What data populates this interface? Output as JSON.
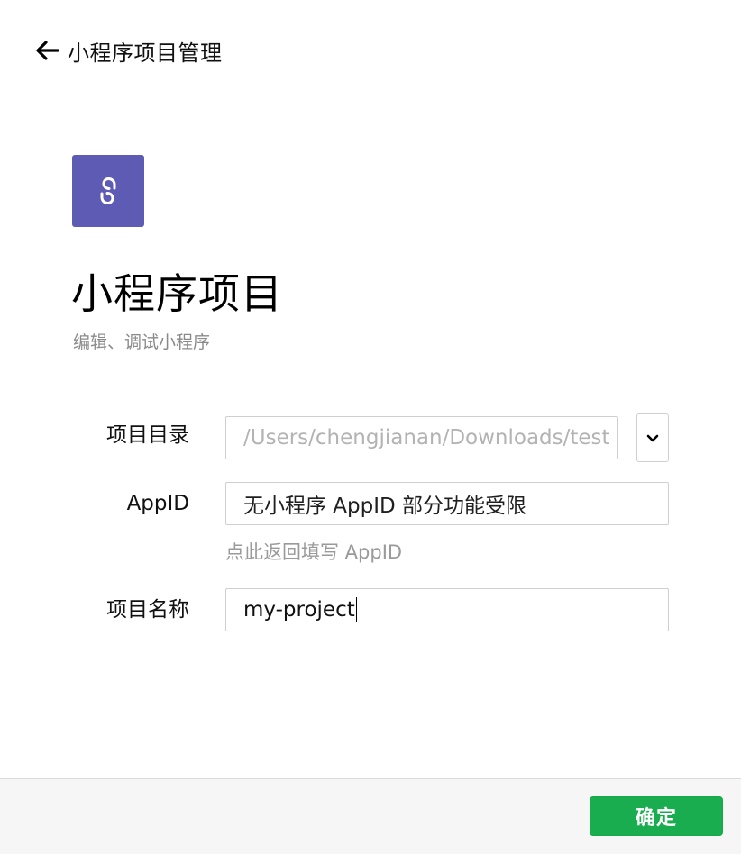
{
  "header": {
    "back_icon": "arrow-left-icon",
    "title": "小程序项目管理"
  },
  "project": {
    "logo_icon": "mini-program-logo-icon",
    "title": "小程序项目",
    "subtitle": "编辑、调试小程序"
  },
  "form": {
    "directory": {
      "label": "项目目录",
      "value": "/Users/chengjianan/Downloads/test",
      "dropdown_icon": "chevron-down-icon"
    },
    "appid": {
      "label": "AppID",
      "value": "无小程序 AppID 部分功能受限",
      "hint_link": "点此返回填写 AppID"
    },
    "name": {
      "label": "项目名称",
      "value": "my-project"
    }
  },
  "footer": {
    "confirm_label": "确定"
  },
  "colors": {
    "logo_bg": "#5e5bb5",
    "confirm_bg": "#1aad4f",
    "label_text": "#111111",
    "hint_text": "#9a9a9a",
    "border": "#cfcfcf"
  }
}
